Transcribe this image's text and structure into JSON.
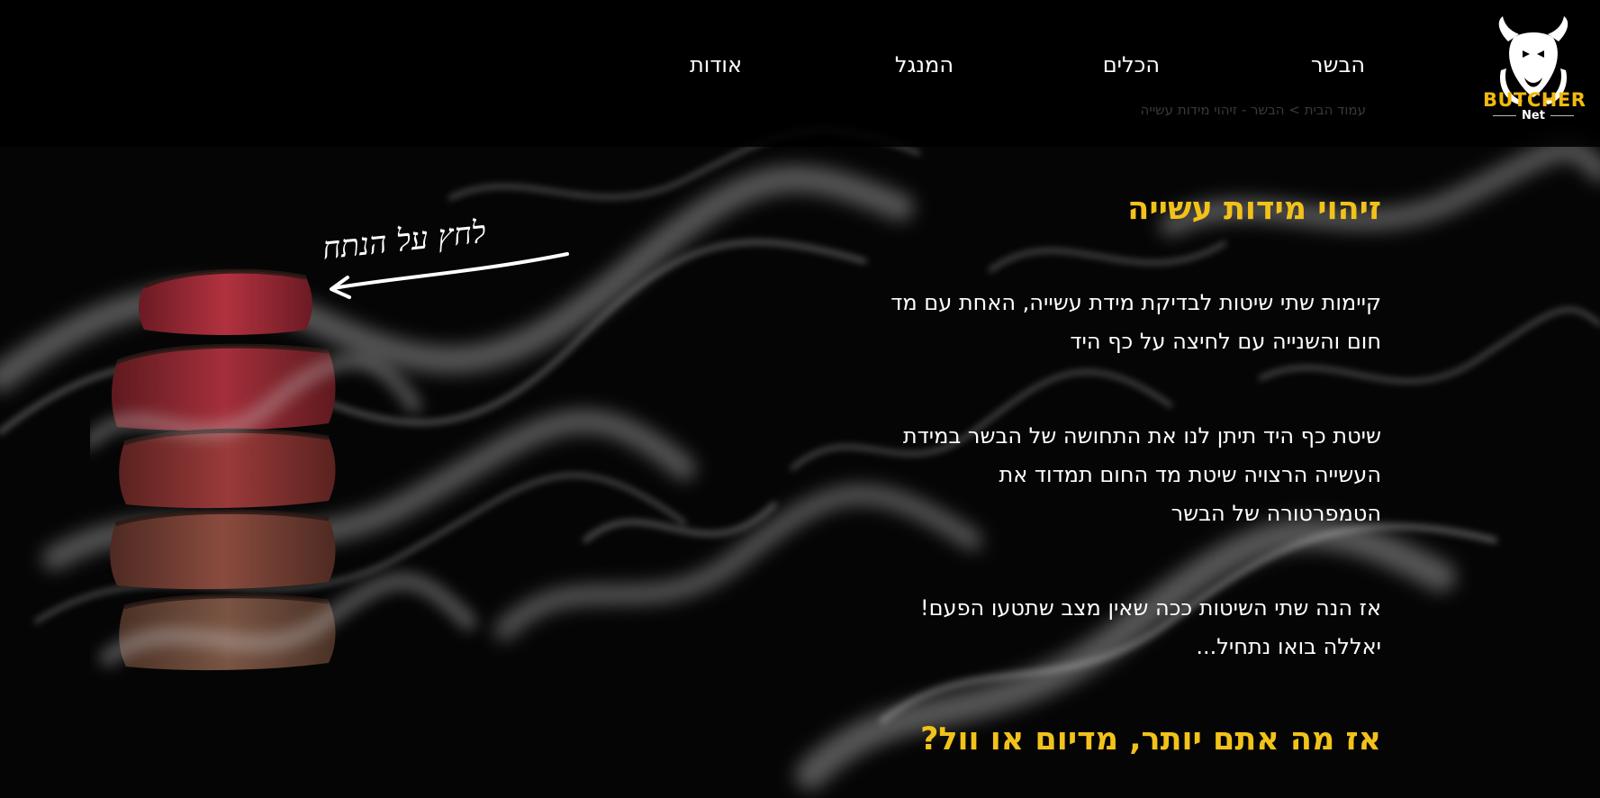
{
  "header": {
    "logo": {
      "brand": "BUTCHER",
      "sub": "Net",
      "icon": "bull-head-icon"
    },
    "nav": [
      {
        "label": "הבשר"
      },
      {
        "label": "הכלים"
      },
      {
        "label": "המנגל"
      },
      {
        "label": "אודות"
      }
    ],
    "breadcrumb": "עמוד הבית > הבשר - זיהוי מידות עשייה"
  },
  "main": {
    "title": "זיהוי מידות עשייה",
    "paragraphs": [
      {
        "lines": [
          "קיימות שתי שיטות לבדיקת מידת עשייה, האחת עם מד",
          "חום והשנייה עם לחיצה על כף היד"
        ]
      },
      {
        "lines": [
          "שיטת כף היד תיתן לנו את התחושה של הבשר במידת",
          "העשייה הרצויה שיטת מד החום תמדוד את",
          "הטמפרטורה של הבשר"
        ]
      },
      {
        "lines": [
          "אז הנה שתי השיטות ככה שאין מצב שתטעו הפעם!",
          "יאללה בואו נתחיל..."
        ]
      }
    ],
    "subtitle": "אז מה אתם יותר, מדיום או וול?"
  },
  "visual": {
    "handwritten_label": "לחץ על הנתח",
    "steak_icon": "steak-doneness-slices-image"
  },
  "colors": {
    "accent": "#f2c21a",
    "background": "#050505",
    "text": "#ffffff"
  }
}
